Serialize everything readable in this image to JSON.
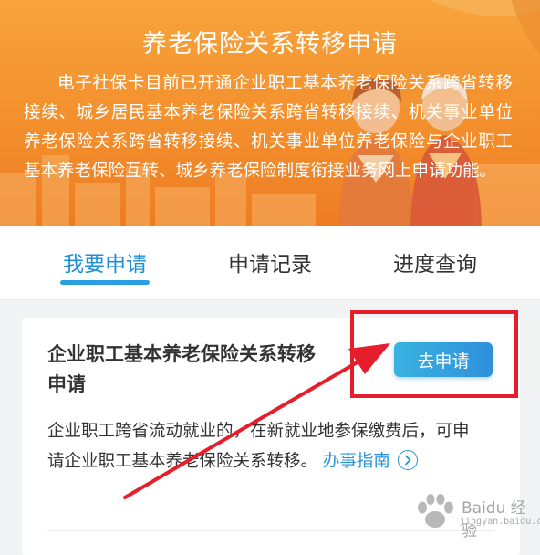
{
  "banner": {
    "title": "养老保险关系转移申请",
    "description": "电子社保卡目前已开通企业职工基本养老保险关系跨省转移接续、城乡居民基本养老保险关系跨省转移接续、机关事业单位养老保险关系跨省转移接续、机关事业单位养老保险与企业职工基本养老保险互转、城乡养老保险制度衔接业务网上申请功能。"
  },
  "tabs": [
    {
      "label": "我要申请",
      "active": true
    },
    {
      "label": "申请记录",
      "active": false
    },
    {
      "label": "进度查询",
      "active": false
    }
  ],
  "card": {
    "title": "企业职工基本养老保险关系转移申请",
    "button_label": "去申请",
    "description": "企业职工跨省流动就业的，在新就业地参保缴费后，可申请企业职工基本养老保险关系转移。",
    "guide_link": "办事指南",
    "guide_icon": "chevron-right-circle-icon"
  },
  "annotation": {
    "highlight_color": "#e61e2b"
  },
  "watermark": {
    "text": "Baidu 经验",
    "sub": "jingyan.baidu.com"
  },
  "colors": {
    "banner_orange": "#f38f2c",
    "accent_blue": "#1e8fd6"
  }
}
